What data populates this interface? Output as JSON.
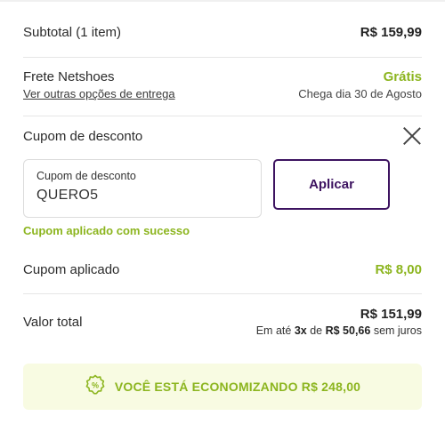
{
  "subtotal": {
    "label": "Subtotal (1 item)",
    "value": "R$ 159,99"
  },
  "shipping": {
    "label": "Frete Netshoes",
    "link": "Ver outras opções de entrega",
    "price": "Grátis",
    "eta": "Chega dia 30 de Agosto"
  },
  "coupon": {
    "section_title": "Cupom de desconto",
    "field_label": "Cupom de desconto",
    "field_value": "QUERO5",
    "apply_label": "Aplicar",
    "success_message": "Cupom aplicado com sucesso"
  },
  "applied": {
    "label": "Cupom aplicado",
    "value": "R$ 8,00"
  },
  "total": {
    "label": "Valor total",
    "value": "R$ 151,99",
    "installments_prefix": "Em até",
    "installments_count": "3x",
    "installments_mid": "de",
    "installments_value": "R$ 50,66",
    "installments_suffix": "sem juros"
  },
  "savings": {
    "text": "VOCÊ ESTÁ ECONOMIZANDO R$ 248,00",
    "icon": "percent-badge-icon"
  },
  "colors": {
    "accent_green": "#8cb51f",
    "brand_purple": "#3d1360",
    "savings_bg": "#f8fbe2"
  }
}
